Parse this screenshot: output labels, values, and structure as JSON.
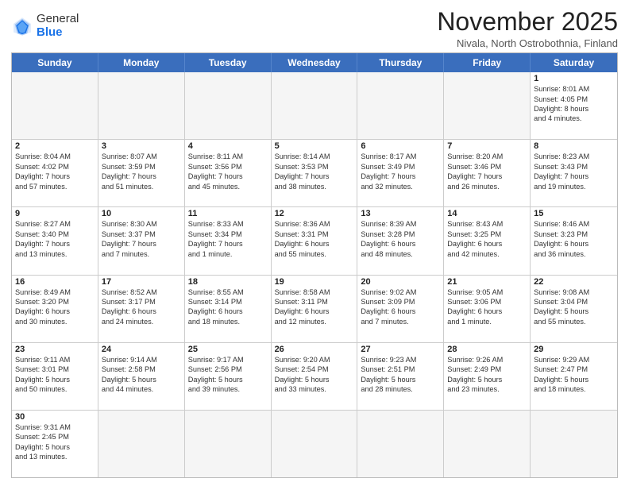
{
  "header": {
    "logo_general": "General",
    "logo_blue": "Blue",
    "month_title": "November 2025",
    "subtitle": "Nivala, North Ostrobothnia, Finland"
  },
  "weekdays": [
    "Sunday",
    "Monday",
    "Tuesday",
    "Wednesday",
    "Thursday",
    "Friday",
    "Saturday"
  ],
  "rows": [
    [
      {
        "day": "",
        "info": ""
      },
      {
        "day": "",
        "info": ""
      },
      {
        "day": "",
        "info": ""
      },
      {
        "day": "",
        "info": ""
      },
      {
        "day": "",
        "info": ""
      },
      {
        "day": "",
        "info": ""
      },
      {
        "day": "1",
        "info": "Sunrise: 8:01 AM\nSunset: 4:05 PM\nDaylight: 8 hours\nand 4 minutes."
      }
    ],
    [
      {
        "day": "2",
        "info": "Sunrise: 8:04 AM\nSunset: 4:02 PM\nDaylight: 7 hours\nand 57 minutes."
      },
      {
        "day": "3",
        "info": "Sunrise: 8:07 AM\nSunset: 3:59 PM\nDaylight: 7 hours\nand 51 minutes."
      },
      {
        "day": "4",
        "info": "Sunrise: 8:11 AM\nSunset: 3:56 PM\nDaylight: 7 hours\nand 45 minutes."
      },
      {
        "day": "5",
        "info": "Sunrise: 8:14 AM\nSunset: 3:53 PM\nDaylight: 7 hours\nand 38 minutes."
      },
      {
        "day": "6",
        "info": "Sunrise: 8:17 AM\nSunset: 3:49 PM\nDaylight: 7 hours\nand 32 minutes."
      },
      {
        "day": "7",
        "info": "Sunrise: 8:20 AM\nSunset: 3:46 PM\nDaylight: 7 hours\nand 26 minutes."
      },
      {
        "day": "8",
        "info": "Sunrise: 8:23 AM\nSunset: 3:43 PM\nDaylight: 7 hours\nand 19 minutes."
      }
    ],
    [
      {
        "day": "9",
        "info": "Sunrise: 8:27 AM\nSunset: 3:40 PM\nDaylight: 7 hours\nand 13 minutes."
      },
      {
        "day": "10",
        "info": "Sunrise: 8:30 AM\nSunset: 3:37 PM\nDaylight: 7 hours\nand 7 minutes."
      },
      {
        "day": "11",
        "info": "Sunrise: 8:33 AM\nSunset: 3:34 PM\nDaylight: 7 hours\nand 1 minute."
      },
      {
        "day": "12",
        "info": "Sunrise: 8:36 AM\nSunset: 3:31 PM\nDaylight: 6 hours\nand 55 minutes."
      },
      {
        "day": "13",
        "info": "Sunrise: 8:39 AM\nSunset: 3:28 PM\nDaylight: 6 hours\nand 48 minutes."
      },
      {
        "day": "14",
        "info": "Sunrise: 8:43 AM\nSunset: 3:25 PM\nDaylight: 6 hours\nand 42 minutes."
      },
      {
        "day": "15",
        "info": "Sunrise: 8:46 AM\nSunset: 3:23 PM\nDaylight: 6 hours\nand 36 minutes."
      }
    ],
    [
      {
        "day": "16",
        "info": "Sunrise: 8:49 AM\nSunset: 3:20 PM\nDaylight: 6 hours\nand 30 minutes."
      },
      {
        "day": "17",
        "info": "Sunrise: 8:52 AM\nSunset: 3:17 PM\nDaylight: 6 hours\nand 24 minutes."
      },
      {
        "day": "18",
        "info": "Sunrise: 8:55 AM\nSunset: 3:14 PM\nDaylight: 6 hours\nand 18 minutes."
      },
      {
        "day": "19",
        "info": "Sunrise: 8:58 AM\nSunset: 3:11 PM\nDaylight: 6 hours\nand 12 minutes."
      },
      {
        "day": "20",
        "info": "Sunrise: 9:02 AM\nSunset: 3:09 PM\nDaylight: 6 hours\nand 7 minutes."
      },
      {
        "day": "21",
        "info": "Sunrise: 9:05 AM\nSunset: 3:06 PM\nDaylight: 6 hours\nand 1 minute."
      },
      {
        "day": "22",
        "info": "Sunrise: 9:08 AM\nSunset: 3:04 PM\nDaylight: 5 hours\nand 55 minutes."
      }
    ],
    [
      {
        "day": "23",
        "info": "Sunrise: 9:11 AM\nSunset: 3:01 PM\nDaylight: 5 hours\nand 50 minutes."
      },
      {
        "day": "24",
        "info": "Sunrise: 9:14 AM\nSunset: 2:58 PM\nDaylight: 5 hours\nand 44 minutes."
      },
      {
        "day": "25",
        "info": "Sunrise: 9:17 AM\nSunset: 2:56 PM\nDaylight: 5 hours\nand 39 minutes."
      },
      {
        "day": "26",
        "info": "Sunrise: 9:20 AM\nSunset: 2:54 PM\nDaylight: 5 hours\nand 33 minutes."
      },
      {
        "day": "27",
        "info": "Sunrise: 9:23 AM\nSunset: 2:51 PM\nDaylight: 5 hours\nand 28 minutes."
      },
      {
        "day": "28",
        "info": "Sunrise: 9:26 AM\nSunset: 2:49 PM\nDaylight: 5 hours\nand 23 minutes."
      },
      {
        "day": "29",
        "info": "Sunrise: 9:29 AM\nSunset: 2:47 PM\nDaylight: 5 hours\nand 18 minutes."
      }
    ],
    [
      {
        "day": "30",
        "info": "Sunrise: 9:31 AM\nSunset: 2:45 PM\nDaylight: 5 hours\nand 13 minutes."
      },
      {
        "day": "",
        "info": ""
      },
      {
        "day": "",
        "info": ""
      },
      {
        "day": "",
        "info": ""
      },
      {
        "day": "",
        "info": ""
      },
      {
        "day": "",
        "info": ""
      },
      {
        "day": "",
        "info": ""
      }
    ]
  ]
}
